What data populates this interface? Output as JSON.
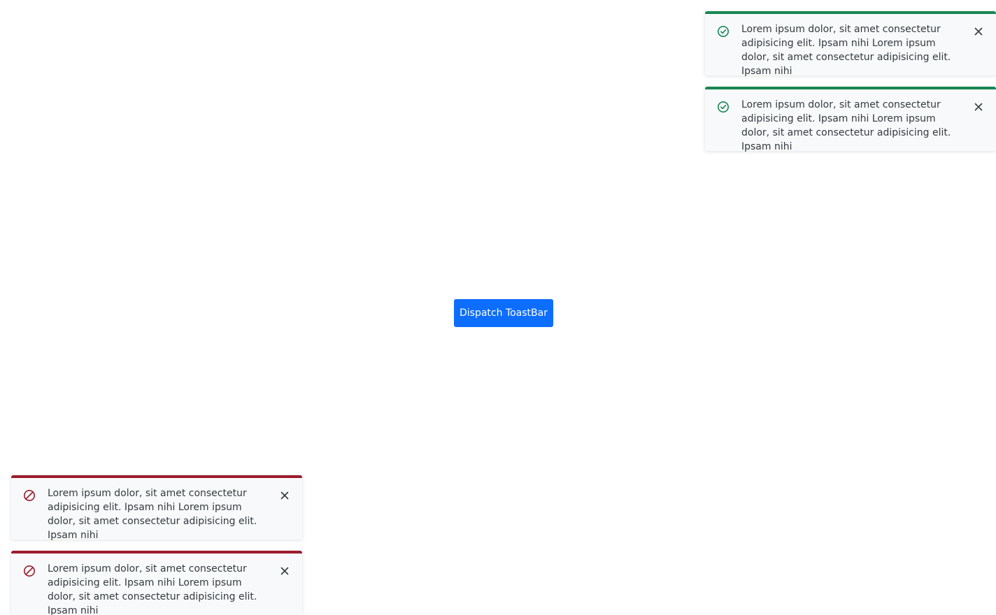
{
  "dispatch_button": {
    "label": "Dispatch ToastBar"
  },
  "colors": {
    "primary": "#0d6efd",
    "success": "#198754",
    "danger": "#9b1c2c",
    "toast_background": "#f8f9fa"
  },
  "toasts": {
    "top_right": [
      {
        "variant": "success",
        "icon": "check-circle-icon",
        "message": "Lorem ipsum dolor, sit amet consectetur adipisicing elit. Ipsam nihi Lorem ipsum dolor, sit amet consectetur adipisicing elit. Ipsam nihi"
      },
      {
        "variant": "success",
        "icon": "check-circle-icon",
        "message": "Lorem ipsum dolor, sit amet consectetur adipisicing elit. Ipsam nihi Lorem ipsum dolor, sit amet consectetur adipisicing elit. Ipsam nihi"
      }
    ],
    "bottom_left": [
      {
        "variant": "danger",
        "icon": "ban-icon",
        "message": "Lorem ipsum dolor, sit amet consectetur adipisicing elit. Ipsam nihi Lorem ipsum dolor, sit amet consectetur adipisicing elit. Ipsam nihi"
      },
      {
        "variant": "danger",
        "icon": "ban-icon",
        "message": "Lorem ipsum dolor, sit amet consectetur adipisicing elit. Ipsam nihi Lorem ipsum dolor, sit amet consectetur adipisicing elit. Ipsam nihi"
      }
    ]
  }
}
